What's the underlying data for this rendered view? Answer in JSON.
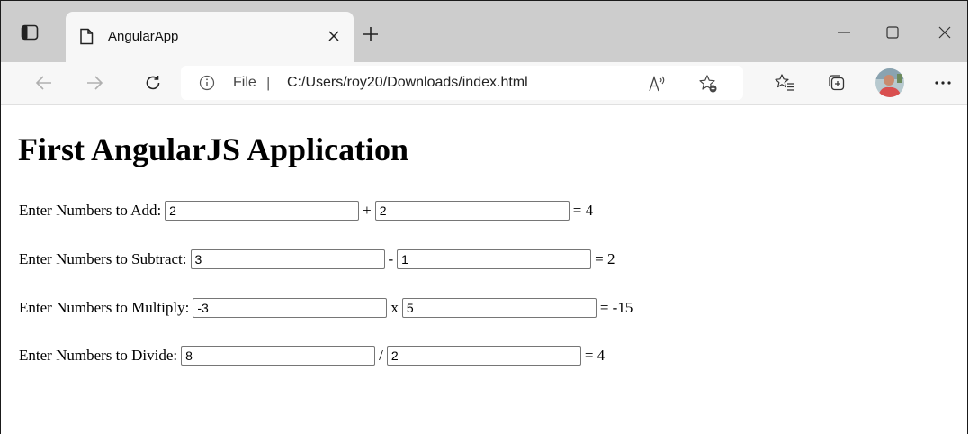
{
  "browser": {
    "tab": {
      "title": "AngularApp"
    },
    "address": {
      "scheme": "File",
      "separator": "|",
      "url": "C:/Users/roy20/Downloads/index.html"
    }
  },
  "page": {
    "heading": "First AngularJS Application",
    "rows": [
      {
        "label": "Enter Numbers to Add:",
        "a": "2",
        "op": "+",
        "b": "2",
        "result": "= 4"
      },
      {
        "label": "Enter Numbers to Subtract:",
        "a": "3",
        "op": "-",
        "b": "1",
        "result": "= 2"
      },
      {
        "label": "Enter Numbers to Multiply:",
        "a": "-3",
        "op": "x",
        "b": "5",
        "result": "= -15"
      },
      {
        "label": "Enter Numbers to Divide:",
        "a": "8",
        "op": "/",
        "b": "2",
        "result": "= 4"
      }
    ]
  }
}
